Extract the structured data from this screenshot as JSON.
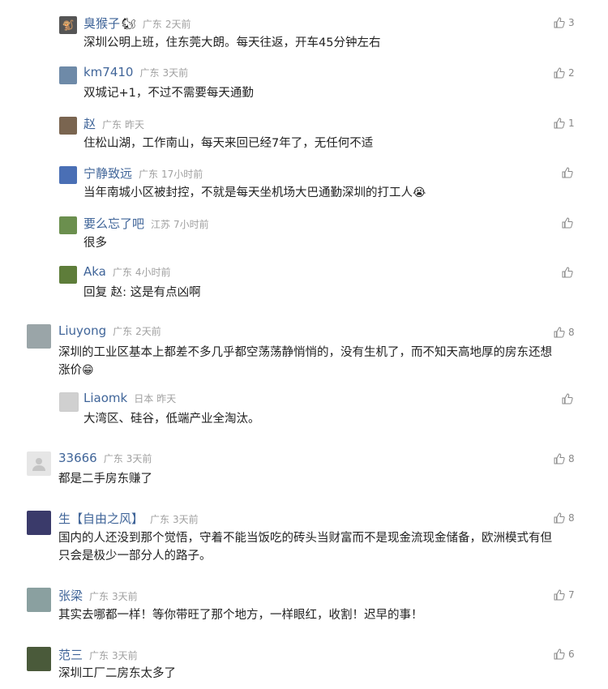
{
  "comments": [
    {
      "name": "臭猴子",
      "badge": "🐿",
      "location": "广东",
      "time": "2天前",
      "text": "深圳公明上班，住东莞大朗。每天往返，开车45分钟左右",
      "likes": "3",
      "avatar_color": "#555555"
    },
    {
      "name": "km7410",
      "location": "广东",
      "time": "3天前",
      "text": "双城记+1，不过不需要每天通勤",
      "likes": "2",
      "avatar_color": "#6e8aa8"
    },
    {
      "name": "赵",
      "location": "广东",
      "time": "昨天",
      "text": "住松山湖，工作南山，每天来回已经7年了，无任何不适",
      "likes": "1",
      "avatar_color": "#7a6550"
    },
    {
      "name": "宁静致远",
      "location": "广东",
      "time": "17小时前",
      "text": "当年南城小区被封控，不就是每天坐机场大巴通勤深圳的打工人",
      "emoji": "😭",
      "likes": "",
      "avatar_color": "#4a6fb5"
    },
    {
      "name": "要么忘了吧",
      "location": "江苏",
      "time": "7小时前",
      "text": "很多",
      "likes": "",
      "avatar_color": "#6b8f4e"
    },
    {
      "name": "Aka",
      "location": "广东",
      "time": "4小时前",
      "text": "回复 赵: 这是有点凶啊",
      "likes": "",
      "avatar_color": "#5e7d3a"
    },
    {
      "name": "Liuyong",
      "location": "广东",
      "time": "2天前",
      "text_line1": "深圳的工业区基本上都差不多几乎都空荡荡静悄悄的，没有生机了，而不知天高地厚的房东还想",
      "text_line2": "涨价",
      "emoji": "😁",
      "likes": "8",
      "avatar_color": "#9aa5a8"
    },
    {
      "name": "Liaomk",
      "location": "日本",
      "time": "昨天",
      "text": "大湾区、硅谷，低端产业全淘汰。",
      "likes": "",
      "avatar_color": "#d0d0d0"
    },
    {
      "name": "33666",
      "location": "广东",
      "time": "3天前",
      "text": "都是二手房东赚了",
      "likes": "8",
      "avatar_color": "#e6e6e6"
    },
    {
      "name": "生【自由之风】",
      "location": "广东",
      "time": "3天前",
      "text_line1": "国内的人还没到那个觉悟，守着不能当饭吃的砖头当财富而不是现金流现金储备，欧洲模式有但",
      "text_line2": "只会是极少一部分人的路子。",
      "likes": "8",
      "avatar_color": "#3a3a6a"
    },
    {
      "name": "张梁",
      "location": "广东",
      "time": "3天前",
      "text": "其实去哪都一样！等你带旺了那个地方，一样眼红，收割！迟早的事！",
      "likes": "7",
      "avatar_color": "#8aa0a0"
    },
    {
      "name": "范三",
      "location": "广东",
      "time": "3天前",
      "text": "深圳工厂二房东太多了",
      "likes": "6",
      "avatar_color": "#4a5a3a"
    }
  ]
}
